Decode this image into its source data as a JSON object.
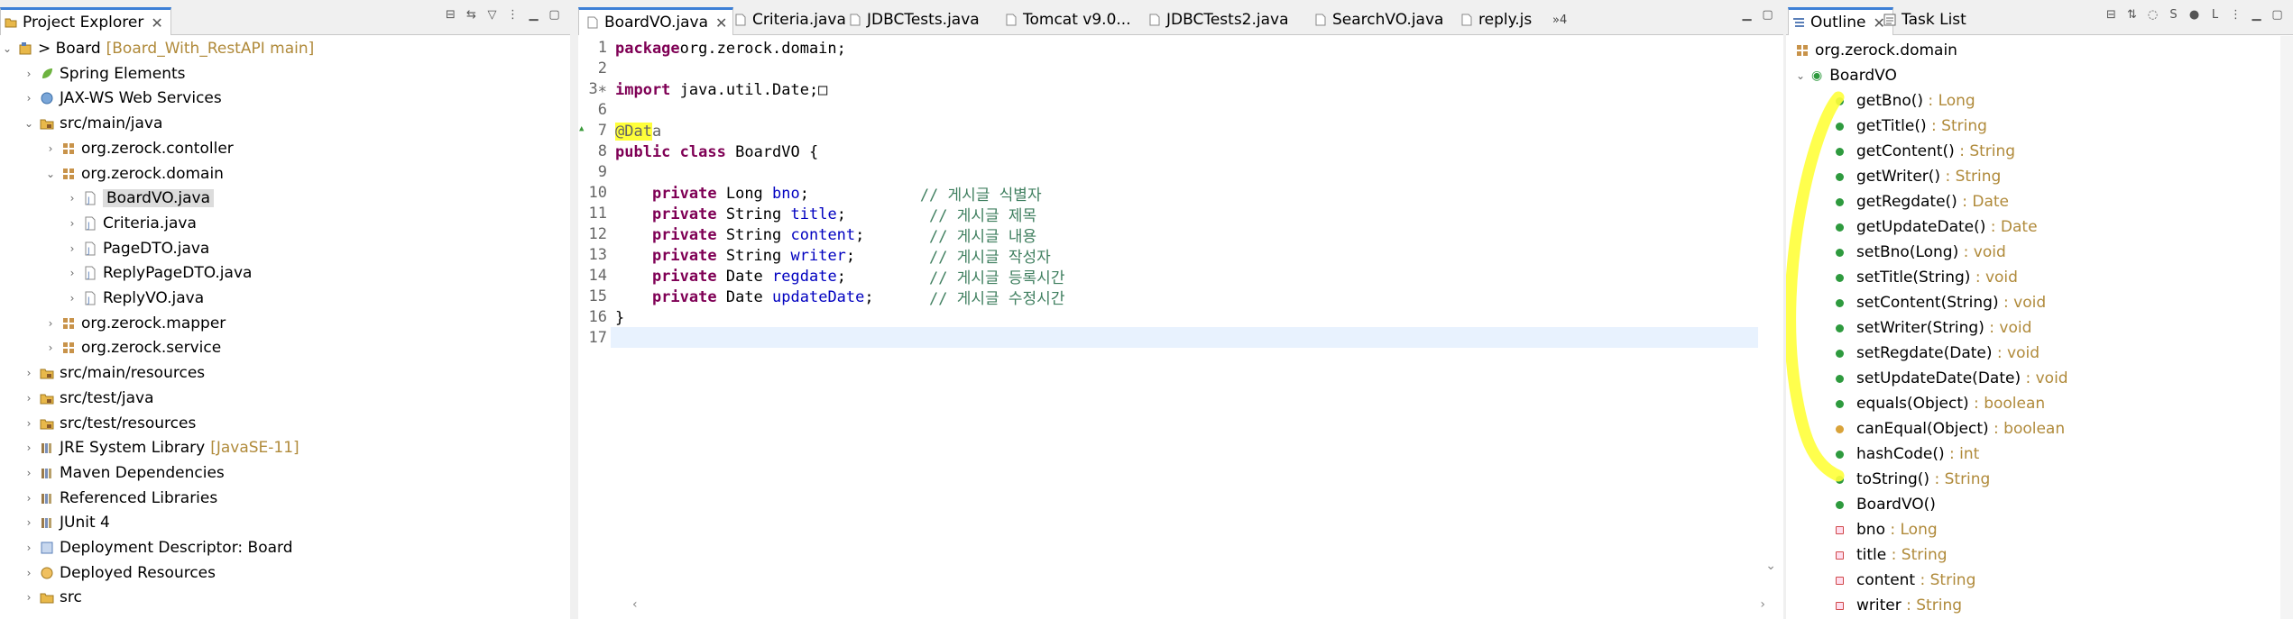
{
  "explorer": {
    "tab": "Project Explorer",
    "tree": [
      {
        "label": "Board",
        "decor": "[Board_With_RestAPI main]",
        "prefix": "> ",
        "level": 0,
        "twisty": "open",
        "icon": "project"
      },
      {
        "label": "Spring Elements",
        "level": 1,
        "twisty": "closed",
        "icon": "spring"
      },
      {
        "label": "JAX-WS Web Services",
        "level": 1,
        "twisty": "closed",
        "icon": "ws"
      },
      {
        "label": "src/main/java",
        "level": 1,
        "twisty": "open",
        "icon": "srcfolder"
      },
      {
        "label": "org.zerock.contoller",
        "level": 2,
        "twisty": "closed",
        "icon": "package"
      },
      {
        "label": "org.zerock.domain",
        "level": 2,
        "twisty": "open",
        "icon": "package"
      },
      {
        "label": "BoardVO.java",
        "level": 3,
        "twisty": "closed",
        "icon": "java",
        "selected": true
      },
      {
        "label": "Criteria.java",
        "level": 3,
        "twisty": "closed",
        "icon": "java"
      },
      {
        "label": "PageDTO.java",
        "level": 3,
        "twisty": "closed",
        "icon": "java"
      },
      {
        "label": "ReplyPageDTO.java",
        "level": 3,
        "twisty": "closed",
        "icon": "java"
      },
      {
        "label": "ReplyVO.java",
        "level": 3,
        "twisty": "closed",
        "icon": "java"
      },
      {
        "label": "org.zerock.mapper",
        "level": 2,
        "twisty": "closed",
        "icon": "package"
      },
      {
        "label": "org.zerock.service",
        "level": 2,
        "twisty": "closed",
        "icon": "package"
      },
      {
        "label": "src/main/resources",
        "level": 1,
        "twisty": "closed",
        "icon": "srcfolder"
      },
      {
        "label": "src/test/java",
        "level": 1,
        "twisty": "closed",
        "icon": "srcfolder"
      },
      {
        "label": "src/test/resources",
        "level": 1,
        "twisty": "closed",
        "icon": "srcfolder"
      },
      {
        "label": "JRE System Library",
        "decor": "[JavaSE-11]",
        "level": 1,
        "twisty": "closed",
        "icon": "library"
      },
      {
        "label": "Maven Dependencies",
        "level": 1,
        "twisty": "closed",
        "icon": "library"
      },
      {
        "label": "Referenced Libraries",
        "level": 1,
        "twisty": "closed",
        "icon": "library"
      },
      {
        "label": "JUnit 4",
        "level": 1,
        "twisty": "closed",
        "icon": "library"
      },
      {
        "label": "Deployment Descriptor: Board",
        "level": 1,
        "twisty": "closed",
        "icon": "dd"
      },
      {
        "label": "Deployed Resources",
        "level": 1,
        "twisty": "closed",
        "icon": "deployed"
      },
      {
        "label": "src",
        "level": 1,
        "twisty": "closed",
        "icon": "folder"
      }
    ]
  },
  "editor": {
    "tabs": [
      "BoardVO.java",
      "Criteria.java",
      "JDBCTests.java",
      "Tomcat v9.0...",
      "JDBCTests2.java",
      "SearchVO.java",
      "reply.js"
    ],
    "overflow": "»4",
    "lines": [
      {
        "n": "1",
        "segs": [
          [
            "kw",
            "package"
          ],
          [
            "",
            "org.zerock.domain;"
          ]
        ]
      },
      {
        "n": "2",
        "segs": []
      },
      {
        "n": "3∗",
        "segs": [
          [
            "kw",
            "import"
          ],
          [
            "",
            " java.util.Date;□"
          ]
        ]
      },
      {
        "n": "6",
        "segs": []
      },
      {
        "n": "7",
        "segs": [
          [
            "hlan",
            "@Dat"
          ],
          [
            "an",
            "a"
          ]
        ]
      },
      {
        "n": "8",
        "segs": [
          [
            "kw",
            "public"
          ],
          [
            "",
            " "
          ],
          [
            "kw",
            "class"
          ],
          [
            "",
            " BoardVO {"
          ]
        ]
      },
      {
        "n": "9",
        "segs": []
      },
      {
        "n": "10",
        "segs": [
          [
            "",
            " "
          ],
          [
            "kw",
            "private"
          ],
          [
            "",
            " Long "
          ],
          [
            "fd",
            "bno"
          ],
          [
            "",
            ";            "
          ],
          [
            "cm",
            "// 게시글 식별자"
          ]
        ]
      },
      {
        "n": "11",
        "segs": [
          [
            "",
            " "
          ],
          [
            "kw",
            "private"
          ],
          [
            "",
            " String "
          ],
          [
            "fd",
            "title"
          ],
          [
            "",
            ";         "
          ],
          [
            "cm",
            "// 게시글 제목"
          ]
        ]
      },
      {
        "n": "12",
        "segs": [
          [
            "",
            " "
          ],
          [
            "kw",
            "private"
          ],
          [
            "",
            " String "
          ],
          [
            "fd",
            "content"
          ],
          [
            "",
            ";       "
          ],
          [
            "cm",
            "// 게시글 내용"
          ]
        ]
      },
      {
        "n": "13",
        "segs": [
          [
            "",
            " "
          ],
          [
            "kw",
            "private"
          ],
          [
            "",
            " String "
          ],
          [
            "fd",
            "writer"
          ],
          [
            "",
            ";        "
          ],
          [
            "cm",
            "// 게시글 작성자"
          ]
        ]
      },
      {
        "n": "14",
        "segs": [
          [
            "",
            " "
          ],
          [
            "kw",
            "private"
          ],
          [
            "",
            " Date "
          ],
          [
            "fd",
            "regdate"
          ],
          [
            "",
            ";         "
          ],
          [
            "cm",
            "// 게시글 등록시간"
          ]
        ]
      },
      {
        "n": "15",
        "segs": [
          [
            "",
            " "
          ],
          [
            "kw",
            "private"
          ],
          [
            "",
            " Date "
          ],
          [
            "fd",
            "updateDate"
          ],
          [
            "",
            ";      "
          ],
          [
            "cm",
            "// 게시글 수정시간"
          ]
        ]
      },
      {
        "n": "16",
        "segs": [
          [
            "",
            "}"
          ]
        ]
      },
      {
        "n": "17",
        "segs": []
      }
    ]
  },
  "outline": {
    "tabs": [
      "Outline",
      "Task List"
    ],
    "items": [
      {
        "name": "org.zerock.domain",
        "type": "",
        "level": 0,
        "kind": "pkg"
      },
      {
        "name": "BoardVO",
        "type": "",
        "level": 0,
        "kind": "class",
        "twisty": "open"
      },
      {
        "name": "getBno()",
        "type": " : Long",
        "level": 1,
        "kind": "pub"
      },
      {
        "name": "getTitle()",
        "type": " : String",
        "level": 1,
        "kind": "pub"
      },
      {
        "name": "getContent()",
        "type": " : String",
        "level": 1,
        "kind": "pub"
      },
      {
        "name": "getWriter()",
        "type": " : String",
        "level": 1,
        "kind": "pub"
      },
      {
        "name": "getRegdate()",
        "type": " : Date",
        "level": 1,
        "kind": "pub"
      },
      {
        "name": "getUpdateDate()",
        "type": " : Date",
        "level": 1,
        "kind": "pub"
      },
      {
        "name": "setBno(Long)",
        "type": " : void",
        "level": 1,
        "kind": "pub"
      },
      {
        "name": "setTitle(String)",
        "type": " : void",
        "level": 1,
        "kind": "pub"
      },
      {
        "name": "setContent(String)",
        "type": " : void",
        "level": 1,
        "kind": "pub"
      },
      {
        "name": "setWriter(String)",
        "type": " : void",
        "level": 1,
        "kind": "pub"
      },
      {
        "name": "setRegdate(Date)",
        "type": " : void",
        "level": 1,
        "kind": "pub"
      },
      {
        "name": "setUpdateDate(Date)",
        "type": " : void",
        "level": 1,
        "kind": "pub"
      },
      {
        "name": "equals(Object)",
        "type": " : boolean",
        "level": 1,
        "kind": "pub"
      },
      {
        "name": "canEqual(Object)",
        "type": " : boolean",
        "level": 1,
        "kind": "prot"
      },
      {
        "name": "hashCode()",
        "type": " : int",
        "level": 1,
        "kind": "pub"
      },
      {
        "name": "toString()",
        "type": " : String",
        "level": 1,
        "kind": "pub"
      },
      {
        "name": "BoardVO()",
        "type": "",
        "level": 1,
        "kind": "pub"
      },
      {
        "name": "bno",
        "type": " : Long",
        "level": 1,
        "kind": "priv"
      },
      {
        "name": "title",
        "type": " : String",
        "level": 1,
        "kind": "priv"
      },
      {
        "name": "content",
        "type": " : String",
        "level": 1,
        "kind": "priv"
      },
      {
        "name": "writer",
        "type": " : String",
        "level": 1,
        "kind": "priv"
      }
    ]
  },
  "colors": {
    "highlight": "#ffff3a",
    "keyword": "#7f0055",
    "field": "#0000c0",
    "comment": "#3f7f5f",
    "decoration": "#b08a3a",
    "public": "#2e9a3e",
    "private": "#d04848",
    "protected": "#d9a33a"
  }
}
